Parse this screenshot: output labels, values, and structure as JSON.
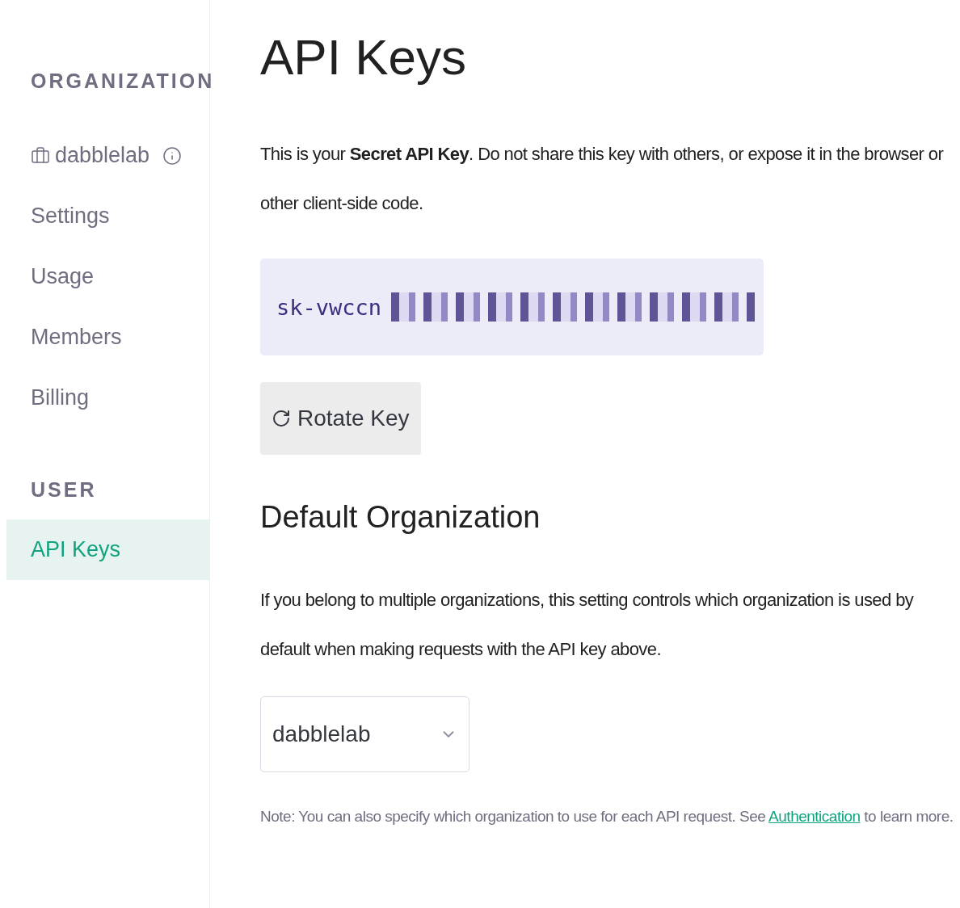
{
  "sidebar": {
    "sections": [
      {
        "heading": "ORGANIZATION",
        "items": [
          {
            "label": "dabblelab",
            "kind": "org",
            "selected": false
          },
          {
            "label": "Settings",
            "kind": "link",
            "selected": false
          },
          {
            "label": "Usage",
            "kind": "link",
            "selected": false
          },
          {
            "label": "Members",
            "kind": "link",
            "selected": false
          },
          {
            "label": "Billing",
            "kind": "link",
            "selected": false
          }
        ]
      },
      {
        "heading": "USER",
        "items": [
          {
            "label": "API Keys",
            "kind": "link",
            "selected": true
          }
        ]
      }
    ]
  },
  "main": {
    "title": "API Keys",
    "intro": "This is your **Secret API Key**. Do not share this key with others, or expose it in the browser or other client-side code.",
    "key_prefix": "sk-vwccn",
    "rotate_button": "Rotate Key",
    "section_title": "Default Organization",
    "section_text": "If you belong to multiple organizations, this setting controls which organization is used by default when making requests with the API key above.",
    "org_select": {
      "value": "dabblelab"
    },
    "note_before": "Note: You can also specify which organization to use for each API request. See",
    "note_link": "Authentication",
    "note_after": "to learn more."
  }
}
